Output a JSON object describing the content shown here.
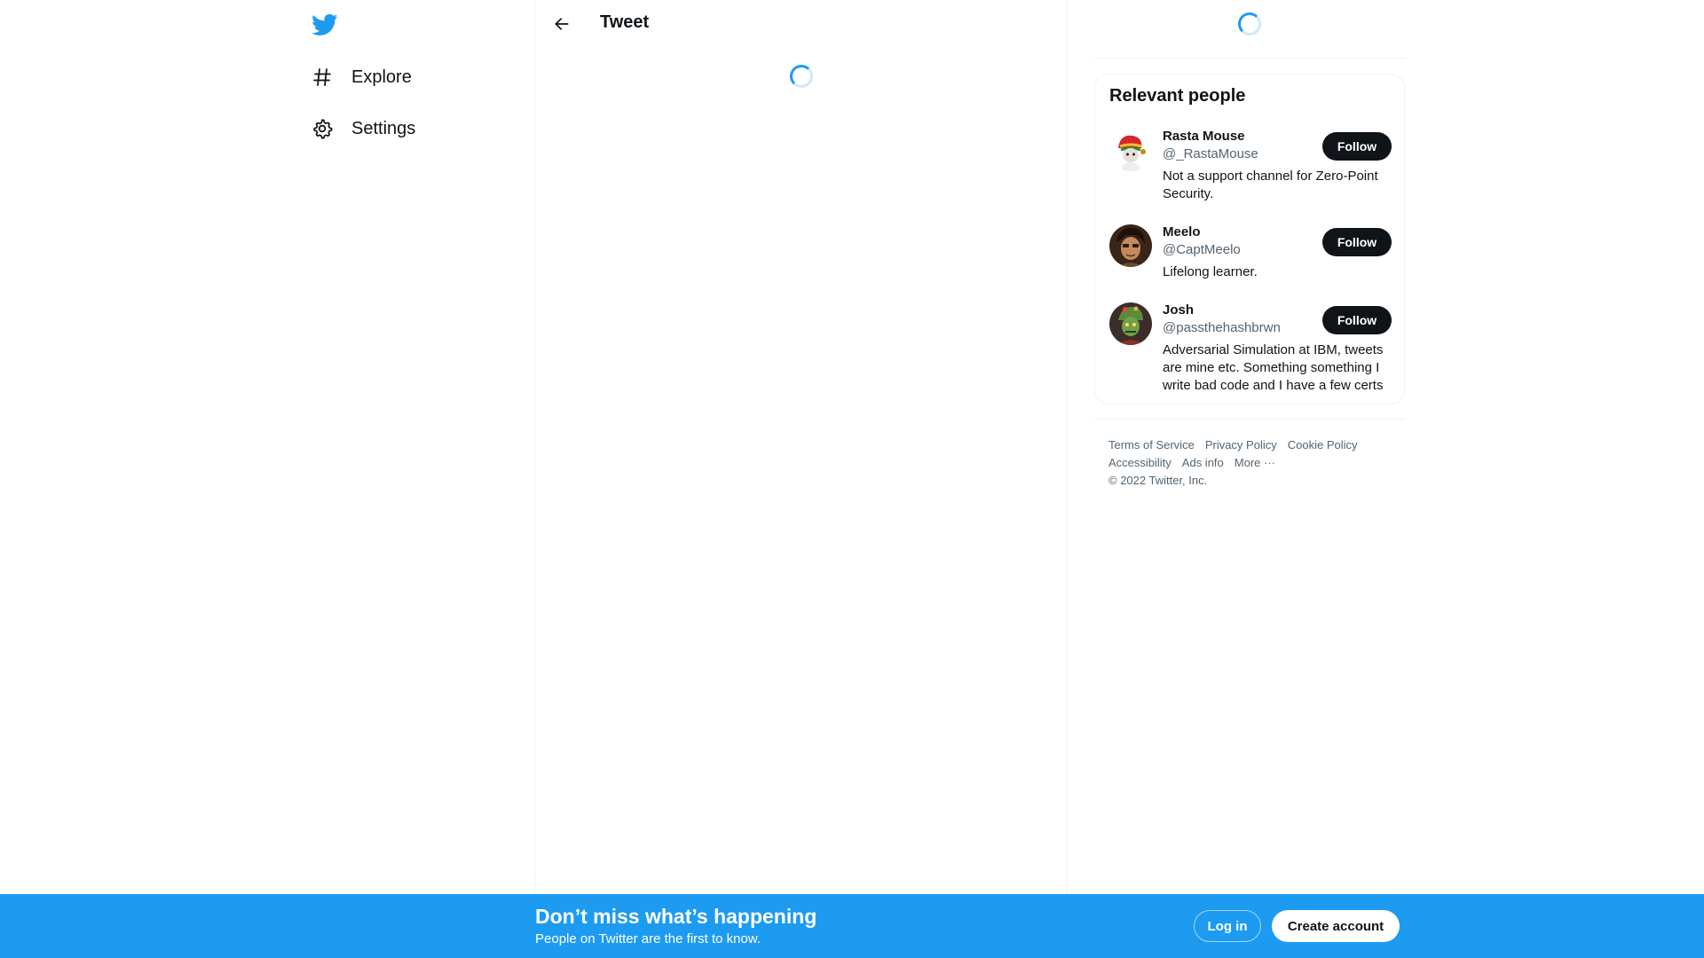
{
  "nav": {
    "logo_icon": "twitter-bird-icon",
    "items": [
      {
        "label": "Explore",
        "icon": "hashtag-icon"
      },
      {
        "label": "Settings",
        "icon": "gear-icon"
      }
    ]
  },
  "main": {
    "title": "Tweet",
    "back_icon": "arrow-left-icon",
    "loading": true
  },
  "sidebar": {
    "loading": true,
    "relevant_people": {
      "title": "Relevant people",
      "people": [
        {
          "name": "Rasta Mouse",
          "handle": "@_RastaMouse",
          "bio": "Not a support channel for Zero-Point Security.",
          "follow_label": "Follow"
        },
        {
          "name": "Meelo",
          "handle": "@CaptMeelo",
          "bio": "Lifelong learner.",
          "follow_label": "Follow"
        },
        {
          "name": "Josh",
          "handle": "@passthehashbrwn",
          "bio": "Adversarial Simulation at IBM, tweets are mine etc. Something something I write bad code and I have a few certs",
          "follow_label": "Follow"
        }
      ]
    },
    "footer": {
      "terms": "Terms of Service",
      "privacy": "Privacy Policy",
      "cookie": "Cookie Policy",
      "accessibility": "Accessibility",
      "ads": "Ads info",
      "more": "More ···",
      "copyright": "© 2022 Twitter, Inc."
    }
  },
  "banner": {
    "title": "Don’t miss what’s happening",
    "subtitle": "People on Twitter are the first to know.",
    "login_label": "Log in",
    "create_label": "Create account"
  },
  "colors": {
    "accent": "#1d9bf0",
    "text": "#0f1419",
    "muted": "#536471",
    "border": "#eff3f4"
  }
}
